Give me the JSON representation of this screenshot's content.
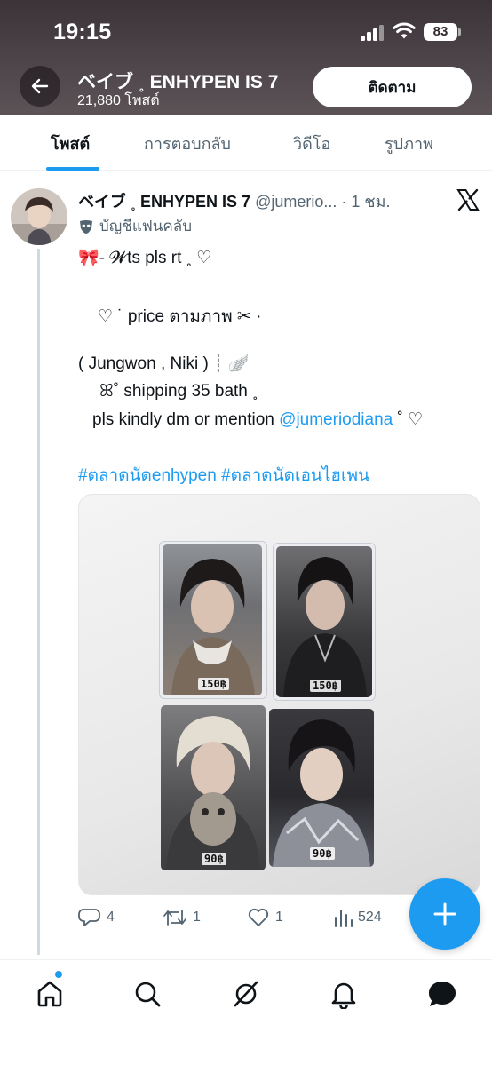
{
  "status_bar": {
    "time": "19:15",
    "battery": "83"
  },
  "header": {
    "title": "ベイブ ˳ ENHYPEN IS 7",
    "subtitle": "21,880 โพสต์",
    "follow_label": "ติดตาม"
  },
  "tabs": [
    {
      "label": "โพสต์",
      "active": true
    },
    {
      "label": "การตอบกลับ",
      "active": false
    },
    {
      "label": "วิดีโอ",
      "active": false
    },
    {
      "label": "รูปภาพ",
      "active": false
    }
  ],
  "post": {
    "author_name": "ベイブ ˳ ENHYPEN IS 7",
    "author_handle": "@jumerio...",
    "time": " · 1 ชม.",
    "badge_label": "บัญชีแฟนคลับ",
    "lines": [
      "🎀-  𝓦ts pls rt ˳ ♡",
      "♡  ˙  price ตามภาพ  ✂︎  ·",
      "( Jungwon , Niki )  ┊  🪽",
      "ꕤ˚ shipping 35 bath ˳",
      "pls kindly dm or mention "
    ],
    "mention": "@jumeriodiana",
    "mention_suffix": "  ˚ ♡",
    "hashtags": "#ตลาดนัดenhypen #ตลาดนัดเอนไฮเพน",
    "prices": [
      "150฿",
      "150฿",
      "90฿",
      "90฿"
    ],
    "stats": {
      "replies": "4",
      "reposts": "1",
      "likes": "1",
      "views": "524"
    }
  },
  "colors": {
    "accent": "#1d9bf0",
    "text": "#0f1419",
    "muted": "#536471"
  },
  "icons": {
    "back": "arrow-left-icon",
    "x_logo": "x-logo-icon",
    "compose": "plus-icon",
    "nav": [
      "home-icon",
      "search-icon",
      "grok-icon",
      "bell-icon",
      "messages-icon"
    ]
  }
}
